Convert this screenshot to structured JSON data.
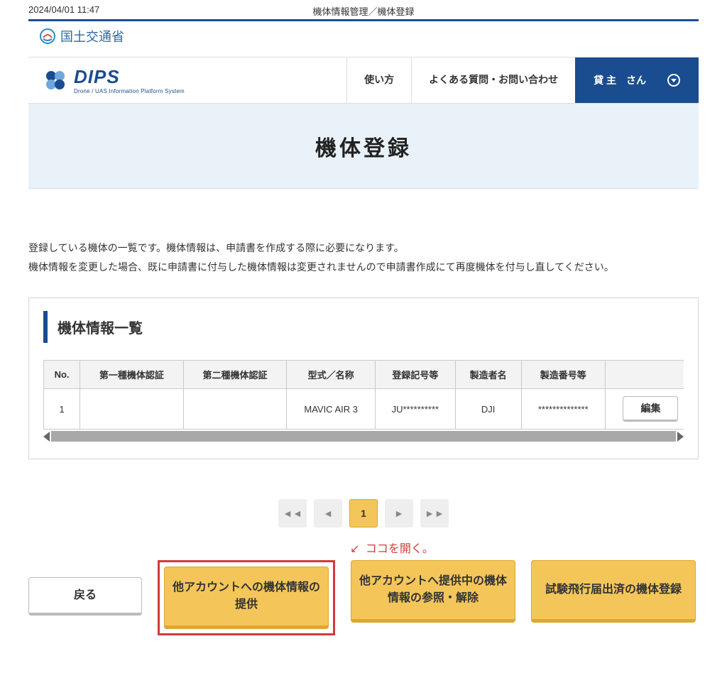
{
  "meta": {
    "timestamp": "2024/04/01 11:47",
    "breadcrumb": "機体情報管理／機体登録"
  },
  "ministry": {
    "name": "国土交通省"
  },
  "logo": {
    "text": "DIPS",
    "sub": "Drone / UAS Information Platform System"
  },
  "nav": {
    "howto": "使い方",
    "faq": "よくある質問・お問い合わせ",
    "user": "貸 主　さん"
  },
  "hero": {
    "title": "機体登録"
  },
  "description": {
    "line1": "登録している機体の一覧です。機体情報は、申請書を作成する際に必要になります。",
    "line2": "機体情報を変更した場合、既に申請書に付与した機体情報は変更されませんので申請書作成にて再度機体を付与し直してください。"
  },
  "list": {
    "title": "機体情報一覧",
    "headers": {
      "no": "No.",
      "cert1": "第一種機体認証",
      "cert2": "第二種機体認証",
      "model": "型式／名称",
      "reg": "登録記号等",
      "maker": "製造者名",
      "serial": "製造番号等"
    },
    "rows": [
      {
        "no": "1",
        "cert1": "",
        "cert2": "",
        "model": "MAVIC AIR 3",
        "reg": "JU**********",
        "maker": "DJI",
        "serial": "**************"
      }
    ],
    "edit_label": "編集"
  },
  "pager": {
    "first": "◄◄",
    "prev": "◄",
    "current": "1",
    "next": "►",
    "last": "►►"
  },
  "annotation": {
    "arrow": "↙",
    "text": "ココを開く。"
  },
  "actions": {
    "back": "戻る",
    "provide": "他アカウントへの機体情報の提供",
    "reference": "他アカウントへ提供中の機体情報の参照・解除",
    "test_flight": "試験飛行届出済の機体登録"
  }
}
